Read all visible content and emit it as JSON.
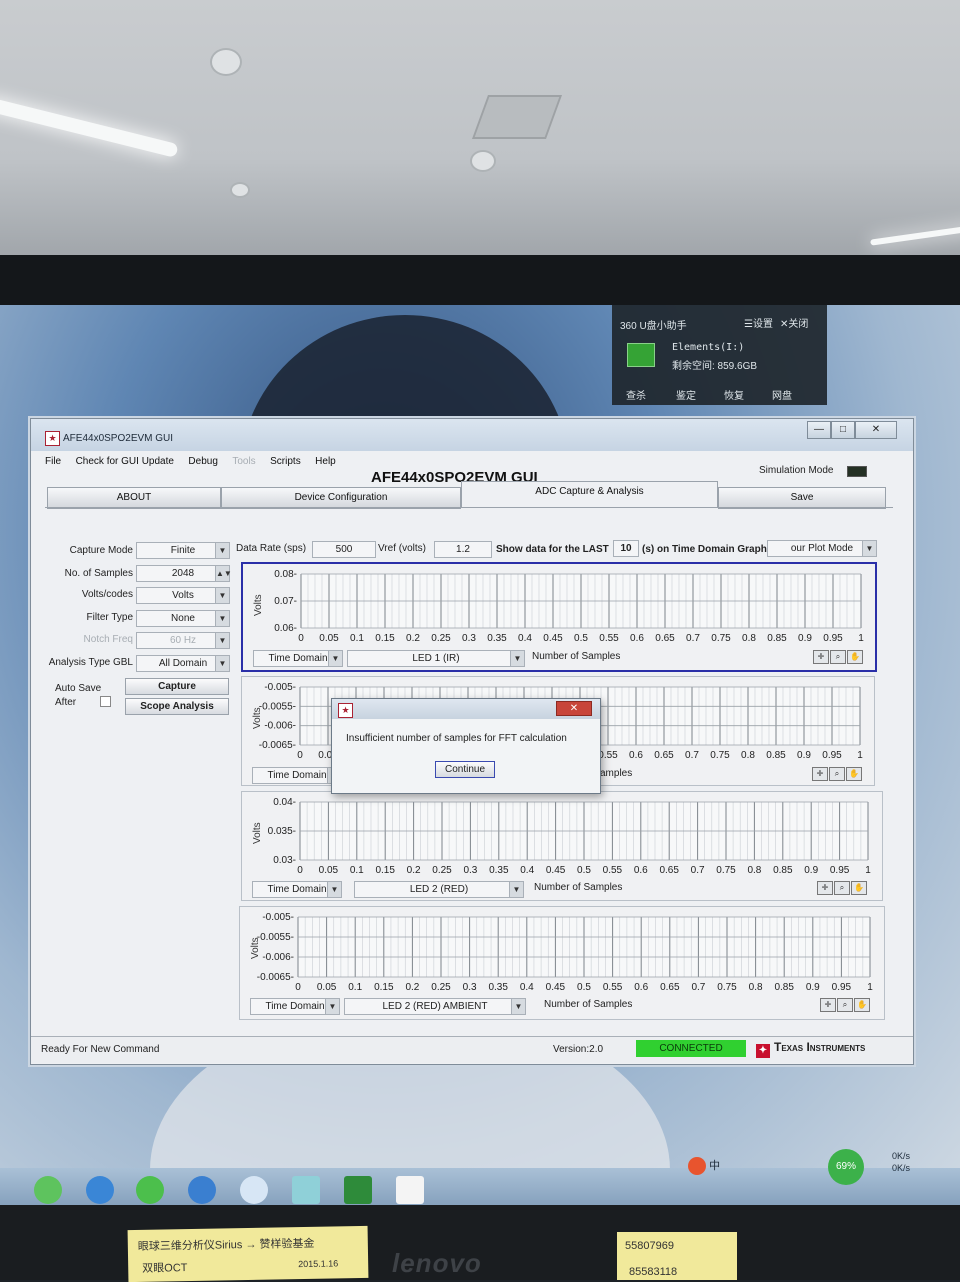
{
  "usb_helper": {
    "title": "360 U盘小助手",
    "settings": "☰设置",
    "close": "✕关闭",
    "drive_name": "Elements(I:)",
    "free_space": "剩余空间: 859.6GB",
    "actions": [
      "查杀",
      "鉴定",
      "恢复",
      "网盘"
    ]
  },
  "window": {
    "title": "AFE44x0SPO2EVM GUI",
    "min_label": "—",
    "max_label": "□",
    "close_label": "✕",
    "menu": [
      {
        "label": "File",
        "enabled": true
      },
      {
        "label": "Check for GUI Update",
        "enabled": true
      },
      {
        "label": "Debug",
        "enabled": true
      },
      {
        "label": "Tools",
        "enabled": false
      },
      {
        "label": "Scripts",
        "enabled": true
      },
      {
        "label": "Help",
        "enabled": true
      }
    ],
    "app_title": "AFE44x0SPO2EVM GUI",
    "simulation_mode": "Simulation Mode",
    "tabs": [
      "ABOUT",
      "Device Configuration",
      "ADC Capture & Analysis",
      "Save"
    ],
    "active_tab": "ADC Capture & Analysis"
  },
  "controls": {
    "capture_mode": {
      "label": "Capture Mode",
      "value": "Finite"
    },
    "no_samples": {
      "label": "No. of Samples",
      "value": "2048"
    },
    "volts_codes": {
      "label": "Volts/codes",
      "value": "Volts"
    },
    "filter_type": {
      "label": "Filter Type",
      "value": "None"
    },
    "notch_freq": {
      "label": "Notch Freq",
      "value": "60 Hz",
      "enabled": false
    },
    "analysis_type": {
      "label": "Analysis Type GBL",
      "value": "All Domain"
    },
    "auto_save": "Auto Save",
    "after": "After",
    "capture_btn": "Capture",
    "scope_btn": "Scope Analysis",
    "data_rate_label": "Data Rate (sps)",
    "data_rate": "500",
    "vref_label": "Vref (volts)",
    "vref": "1.2",
    "show_last_label": "Show data for the LAST",
    "show_last_value": "10",
    "show_last_suffix": "(s) on Time Domain Graph",
    "plot_mode": "our Plot Mode"
  },
  "graphs": [
    {
      "domain": "Time Domain",
      "signal": "LED 1 (IR)",
      "xlabel": "Number of Samples",
      "ylabel": "Volts",
      "yticks": [
        "0.08",
        "0.07",
        "0.06"
      ]
    },
    {
      "domain": "Time Domain",
      "signal": "",
      "xlabel": "amples",
      "ylabel": "Volts",
      "yticks": [
        "-0.005",
        "-0.0055",
        "-0.006",
        "-0.0065"
      ]
    },
    {
      "domain": "Time Domain",
      "signal": "LED 2 (RED)",
      "xlabel": "Number of Samples",
      "ylabel": "Volts",
      "yticks": [
        "0.04",
        "0.035",
        "0.03"
      ]
    },
    {
      "domain": "Time Domain",
      "signal": "LED 2 (RED) AMBIENT",
      "xlabel": "Number of Samples",
      "ylabel": "Volts",
      "yticks": [
        "-0.005",
        "-0.0055",
        "-0.006",
        "-0.0065"
      ]
    }
  ],
  "xticks": [
    "0",
    "0.05",
    "0.1",
    "0.15",
    "0.2",
    "0.25",
    "0.3",
    "0.35",
    "0.4",
    "0.45",
    "0.5",
    "0.55",
    "0.6",
    "0.65",
    "0.7",
    "0.75",
    "0.8",
    "0.85",
    "0.9",
    "0.95",
    "1"
  ],
  "xticks_partial": [
    "0.55",
    "0.6",
    "0.65",
    "0.7",
    "0.75",
    "0.8",
    "0.85",
    "0.9",
    "0.95",
    "1"
  ],
  "dialog": {
    "message": "Insufficient number of samples for FFT calculation",
    "button": "Continue",
    "close": "✕"
  },
  "status": {
    "message": "Ready For New Command",
    "version": "Version:2.0",
    "connection": "CONNECTED",
    "vendor": "Texas Instruments"
  },
  "taskbar": {
    "tray_percent": "69%",
    "net_up": "0K/s",
    "net_down": "0K/s",
    "ime": "中"
  },
  "stickers": {
    "note1_line1": "眼球三维分析仪Sirius → 赞样验基金",
    "note1_line2": "双眼OCT",
    "note1_date": "2015.1.16",
    "note2_line1": "55807969",
    "note2_line2": "85583118"
  },
  "monitor_brand": "lenovo",
  "colors": {
    "selected_border": "#2a2fa8",
    "connected": "#30d030",
    "ti_red": "#c8102e"
  }
}
